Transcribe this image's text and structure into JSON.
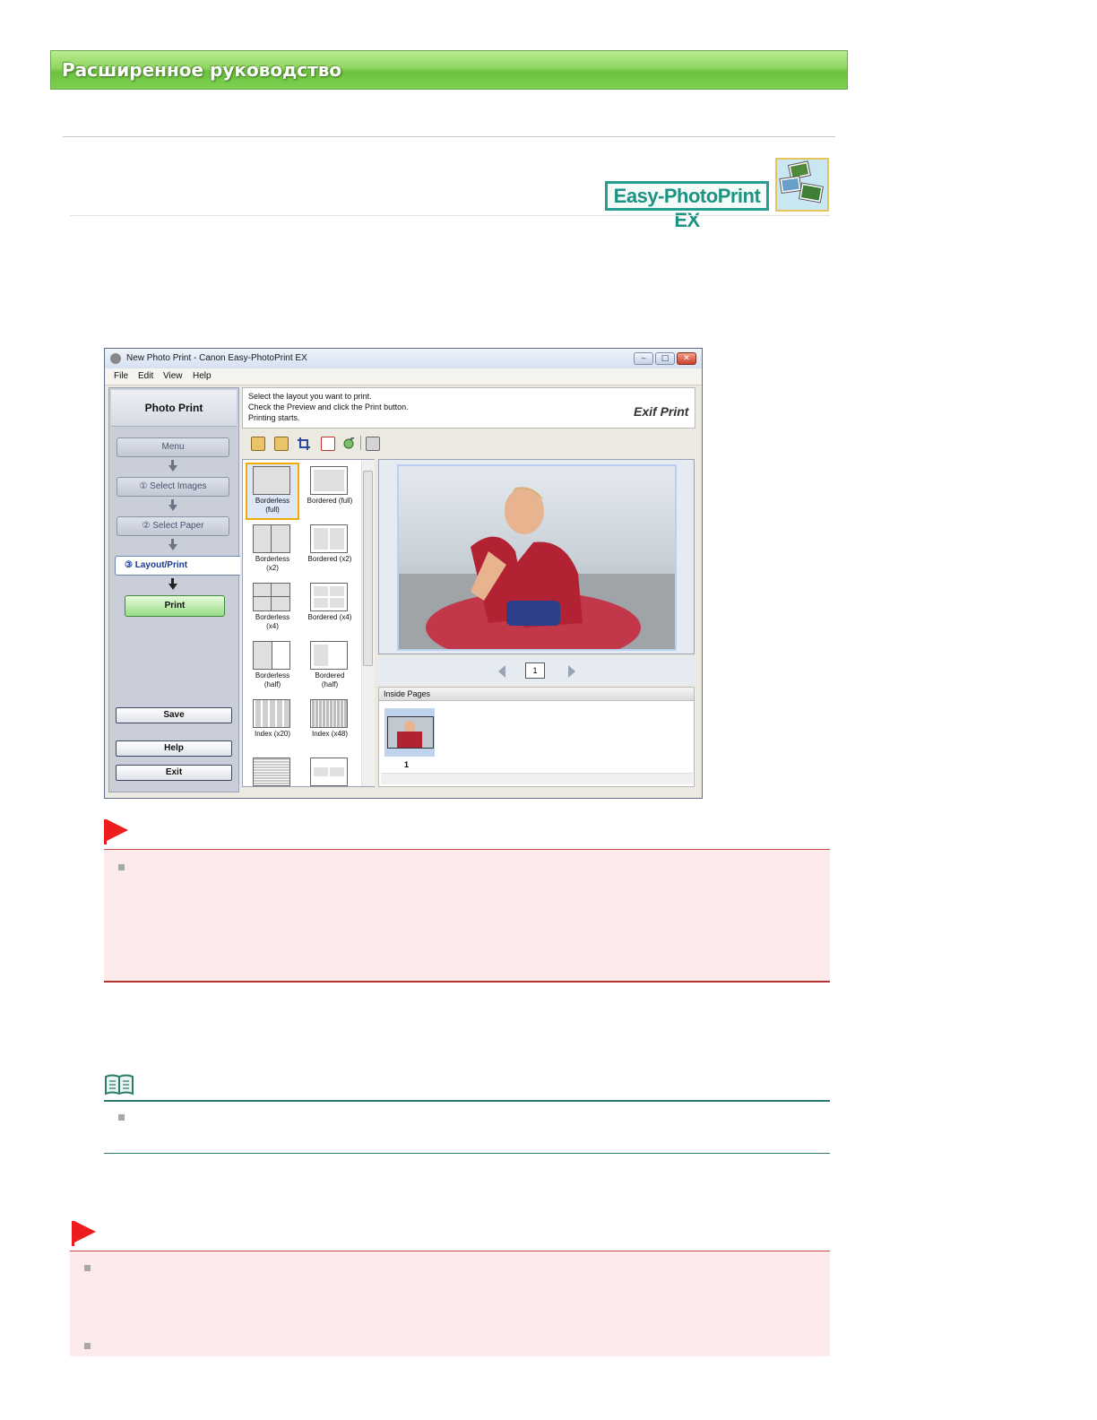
{
  "header": {
    "title": "Расширенное руководство"
  },
  "brand": {
    "label": "Easy-PhotoPrint EX",
    "icon": "photos-stack-icon"
  },
  "app_window": {
    "title": "New Photo Print - Canon Easy-PhotoPrint EX",
    "window_buttons": {
      "minimize": "‒",
      "maximize": "□",
      "close": "✕"
    },
    "menu": [
      "File",
      "Edit",
      "View",
      "Help"
    ],
    "left_panel": {
      "heading": "Photo Print",
      "menu_button": "Menu",
      "step1": "①  Select Images",
      "step2": "②  Select Paper",
      "step3": "③  Layout/Print",
      "print_button": "Print",
      "save_button": "Save",
      "help_button": "Help",
      "exit_button": "Exit"
    },
    "instructions": {
      "line1": "Select the layout you want to print.",
      "line2": "Check the Preview and click the Print button.",
      "line3": "Printing starts."
    },
    "exif_logo": "Exif Print",
    "toolbar_icons": [
      "rotate-left-icon",
      "rotate-right-icon",
      "crop-icon",
      "frame-icon",
      "correct-image-icon",
      "print-settings-icon"
    ],
    "layouts": [
      {
        "label1": "Borderless",
        "label2": "(full)",
        "selected": true
      },
      {
        "label1": "Bordered (full)",
        "label2": ""
      },
      {
        "label1": "Borderless",
        "label2": "(x2)"
      },
      {
        "label1": "Bordered (x2)",
        "label2": ""
      },
      {
        "label1": "Borderless",
        "label2": "(x4)"
      },
      {
        "label1": "Bordered (x4)",
        "label2": ""
      },
      {
        "label1": "Borderless",
        "label2": "(half)"
      },
      {
        "label1": "Bordered",
        "label2": "(half)"
      },
      {
        "label1": "Index (x20)",
        "label2": ""
      },
      {
        "label1": "Index (x48)",
        "label2": ""
      }
    ],
    "page_number": "1",
    "inside_pages_label": "Inside Pages",
    "thumbnail_number": "1"
  },
  "colors": {
    "banner": "#7fd052",
    "brand": "#1d9383",
    "warning": "#ee1c1c",
    "note": "#2b7b6d"
  }
}
